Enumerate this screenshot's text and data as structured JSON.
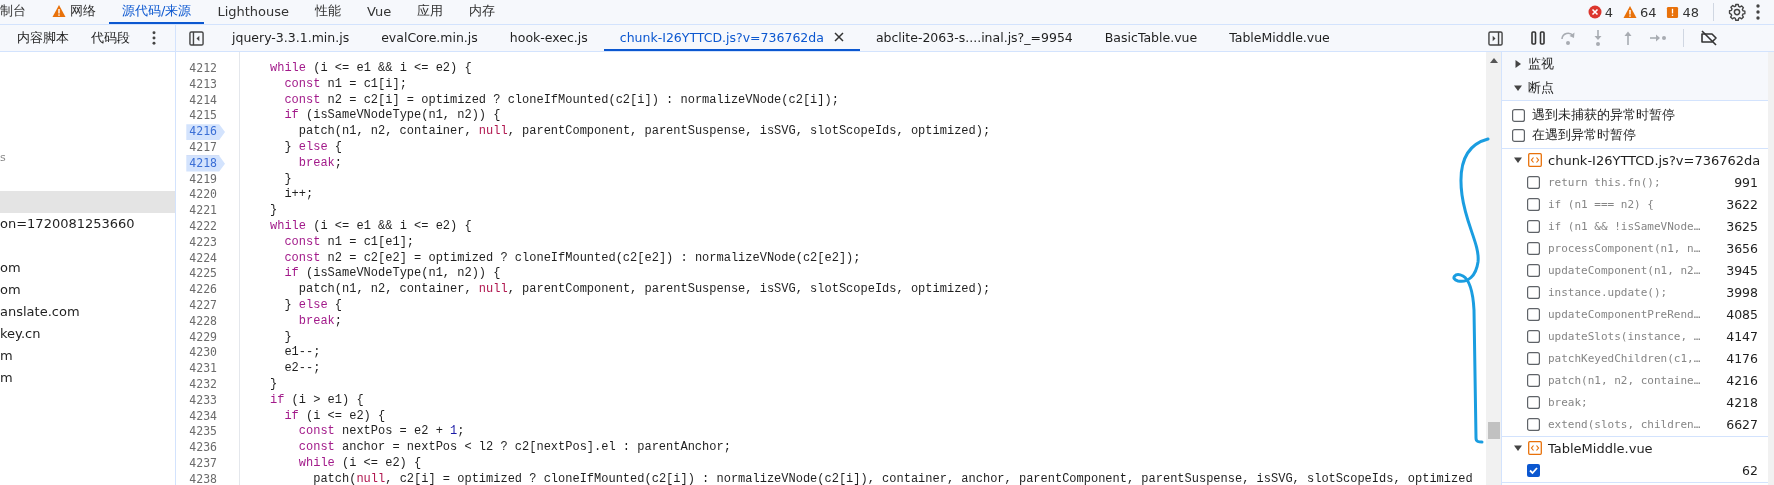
{
  "main_tabs": [
    {
      "label": "制台",
      "selected": false,
      "warning": false
    },
    {
      "label": "网络",
      "selected": false,
      "warning": true
    },
    {
      "label": "源代码/来源",
      "selected": true,
      "warning": false
    },
    {
      "label": "Lighthouse",
      "selected": false,
      "warning": false
    },
    {
      "label": "性能",
      "selected": false,
      "warning": false
    },
    {
      "label": "Vue",
      "selected": false,
      "warning": false
    },
    {
      "label": "应用",
      "selected": false,
      "warning": false
    },
    {
      "label": "内存",
      "selected": false,
      "warning": false
    }
  ],
  "console_counts": {
    "errors": "4",
    "warnings": "64",
    "issues": "48"
  },
  "navigator_tabs": [
    {
      "label": "内容脚本"
    },
    {
      "label": "代码段"
    }
  ],
  "file_tabs": [
    {
      "label": "jquery-3.3.1.min.js",
      "selected": false
    },
    {
      "label": "evalCore.min.js",
      "selected": false
    },
    {
      "label": "hook-exec.js",
      "selected": false
    },
    {
      "label": "chunk-I26YTTCD.js?v=736762da",
      "selected": true
    },
    {
      "label": "abclite-2063-s....inal.js?_=9954",
      "selected": false
    },
    {
      "label": "BasicTable.vue",
      "selected": false
    },
    {
      "label": "TableMiddle.vue",
      "selected": false
    }
  ],
  "debug_buttons": [
    {
      "kind": "pause",
      "disabled": false
    },
    {
      "kind": "step-over",
      "disabled": true
    },
    {
      "kind": "step-into",
      "disabled": true
    },
    {
      "kind": "step-out",
      "disabled": true
    },
    {
      "kind": "step",
      "disabled": true
    },
    {
      "kind": "deactivate",
      "disabled": false
    }
  ],
  "file_tree": [
    {
      "kind": "note",
      "label": "s",
      "selected": false
    },
    {
      "kind": "blank",
      "selected": false
    },
    {
      "kind": "blank",
      "selected": true
    },
    {
      "kind": "file",
      "label": "on=1720081253660",
      "selected": false
    },
    {
      "kind": "blank",
      "selected": false
    },
    {
      "kind": "file",
      "label": "om",
      "selected": false
    },
    {
      "kind": "file",
      "label": "om",
      "selected": false
    },
    {
      "kind": "file",
      "label": "anslate.com",
      "selected": false
    },
    {
      "kind": "file",
      "label": "key.cn",
      "selected": false
    },
    {
      "kind": "file",
      "label": "m",
      "selected": false
    },
    {
      "kind": "file",
      "label": "m",
      "selected": false
    }
  ],
  "editor": {
    "lines": [
      {
        "number": "4212",
        "breakpoint": false,
        "tokens": [
          {
            "kind": "keyword",
            "text": "while"
          },
          {
            "kind": "plain",
            "text": " (i <= e1 && i <= e2) {"
          }
        ]
      },
      {
        "number": "4213",
        "breakpoint": false,
        "tokens": [
          {
            "kind": "keyword",
            "text": "  const"
          },
          {
            "kind": "plain",
            "text": " n1 = c1[i];"
          }
        ]
      },
      {
        "number": "4214",
        "breakpoint": false,
        "tokens": [
          {
            "kind": "keyword",
            "text": "  const"
          },
          {
            "kind": "plain",
            "text": " n2 = c2[i] = optimized ? cloneIfMounted(c2[i]) : normalizeVNode(c2[i]);"
          }
        ]
      },
      {
        "number": "4215",
        "breakpoint": false,
        "tokens": [
          {
            "kind": "keyword",
            "text": "  if"
          },
          {
            "kind": "plain",
            "text": " (isSameVNodeType(n1, n2)) {"
          }
        ]
      },
      {
        "number": "4216",
        "breakpoint": true,
        "tokens": [
          {
            "kind": "plain",
            "text": "    patch(n1, n2, container, "
          },
          {
            "kind": "literal",
            "text": "null"
          },
          {
            "kind": "plain",
            "text": ", parentComponent, parentSuspense, isSVG, slotScopeIds, optimized);"
          }
        ]
      },
      {
        "number": "4217",
        "breakpoint": false,
        "tokens": [
          {
            "kind": "plain",
            "text": "  } "
          },
          {
            "kind": "keyword",
            "text": "else"
          },
          {
            "kind": "plain",
            "text": " {"
          }
        ]
      },
      {
        "number": "4218",
        "breakpoint": true,
        "tokens": [
          {
            "kind": "keyword",
            "text": "    break"
          },
          {
            "kind": "plain",
            "text": ";"
          }
        ]
      },
      {
        "number": "4219",
        "breakpoint": false,
        "tokens": [
          {
            "kind": "plain",
            "text": "  }"
          }
        ]
      },
      {
        "number": "4220",
        "breakpoint": false,
        "tokens": [
          {
            "kind": "plain",
            "text": "  i++;"
          }
        ]
      },
      {
        "number": "4221",
        "breakpoint": false,
        "tokens": [
          {
            "kind": "plain",
            "text": "}"
          }
        ]
      },
      {
        "number": "4222",
        "breakpoint": false,
        "tokens": [
          {
            "kind": "keyword",
            "text": "while"
          },
          {
            "kind": "plain",
            "text": " (i <= e1 && i <= e2) {"
          }
        ]
      },
      {
        "number": "4223",
        "breakpoint": false,
        "tokens": [
          {
            "kind": "keyword",
            "text": "  const"
          },
          {
            "kind": "plain",
            "text": " n1 = c1[e1];"
          }
        ]
      },
      {
        "number": "4224",
        "breakpoint": false,
        "tokens": [
          {
            "kind": "keyword",
            "text": "  const"
          },
          {
            "kind": "plain",
            "text": " n2 = c2[e2] = optimized ? cloneIfMounted(c2[e2]) : normalizeVNode(c2[e2]);"
          }
        ]
      },
      {
        "number": "4225",
        "breakpoint": false,
        "tokens": [
          {
            "kind": "keyword",
            "text": "  if"
          },
          {
            "kind": "plain",
            "text": " (isSameVNodeType(n1, n2)) {"
          }
        ]
      },
      {
        "number": "4226",
        "breakpoint": false,
        "tokens": [
          {
            "kind": "plain",
            "text": "    patch(n1, n2, container, "
          },
          {
            "kind": "literal",
            "text": "null"
          },
          {
            "kind": "plain",
            "text": ", parentComponent, parentSuspense, isSVG, slotScopeIds, optimized);"
          }
        ]
      },
      {
        "number": "4227",
        "breakpoint": false,
        "tokens": [
          {
            "kind": "plain",
            "text": "  } "
          },
          {
            "kind": "keyword",
            "text": "else"
          },
          {
            "kind": "plain",
            "text": " {"
          }
        ]
      },
      {
        "number": "4228",
        "breakpoint": false,
        "tokens": [
          {
            "kind": "keyword",
            "text": "    break"
          },
          {
            "kind": "plain",
            "text": ";"
          }
        ]
      },
      {
        "number": "4229",
        "breakpoint": false,
        "tokens": [
          {
            "kind": "plain",
            "text": "  }"
          }
        ]
      },
      {
        "number": "4230",
        "breakpoint": false,
        "tokens": [
          {
            "kind": "plain",
            "text": "  e1--;"
          }
        ]
      },
      {
        "number": "4231",
        "breakpoint": false,
        "tokens": [
          {
            "kind": "plain",
            "text": "  e2--;"
          }
        ]
      },
      {
        "number": "4232",
        "breakpoint": false,
        "tokens": [
          {
            "kind": "plain",
            "text": "}"
          }
        ]
      },
      {
        "number": "4233",
        "breakpoint": false,
        "tokens": [
          {
            "kind": "keyword",
            "text": "if"
          },
          {
            "kind": "plain",
            "text": " (i > e1) {"
          }
        ]
      },
      {
        "number": "4234",
        "breakpoint": false,
        "tokens": [
          {
            "kind": "keyword",
            "text": "  if"
          },
          {
            "kind": "plain",
            "text": " (i <= e2) {"
          }
        ]
      },
      {
        "number": "4235",
        "breakpoint": false,
        "tokens": [
          {
            "kind": "keyword",
            "text": "    const"
          },
          {
            "kind": "plain",
            "text": " nextPos = e2 + "
          },
          {
            "kind": "number",
            "text": "1"
          },
          {
            "kind": "plain",
            "text": ";"
          }
        ]
      },
      {
        "number": "4236",
        "breakpoint": false,
        "tokens": [
          {
            "kind": "keyword",
            "text": "    const"
          },
          {
            "kind": "plain",
            "text": " anchor = nextPos < l2 ? c2[nextPos].el : parentAnchor;"
          }
        ]
      },
      {
        "number": "4237",
        "breakpoint": false,
        "tokens": [
          {
            "kind": "keyword",
            "text": "    while"
          },
          {
            "kind": "plain",
            "text": " (i <= e2) {"
          }
        ]
      },
      {
        "number": "4238",
        "breakpoint": false,
        "tokens": [
          {
            "kind": "plain",
            "text": "      patch("
          },
          {
            "kind": "literal",
            "text": "null"
          },
          {
            "kind": "plain",
            "text": ", c2[i] = optimized ? cloneIfMounted(c2[i]) : normalizeVNode(c2[i]), container, anchor, parentComponent, parentSuspense, isSVG, slotScopeIds, optimized"
          }
        ]
      }
    ]
  },
  "debugger_sections": [
    {
      "title": "监视",
      "expanded": false
    },
    {
      "title": "断点",
      "expanded": true,
      "pause_options": [
        {
          "label": "遇到未捕获的异常时暂停",
          "checked": false
        },
        {
          "label": "在遇到异常时暂停",
          "checked": false
        }
      ],
      "files": [
        {
          "file": "chunk-I26YTTCD.js?v=736762da",
          "expanded": true,
          "breakpoints": [
            {
              "code": "return this.fn();",
              "line": "991",
              "checked": false
            },
            {
              "code": "if (n1 === n2) {",
              "line": "3622",
              "checked": false
            },
            {
              "code": "if (n1 && !isSameVNode…",
              "line": "3625",
              "checked": false
            },
            {
              "code": "processComponent(n1, n…",
              "line": "3656",
              "checked": false
            },
            {
              "code": "updateComponent(n1, n2…",
              "line": "3945",
              "checked": false
            },
            {
              "code": "instance.update();",
              "line": "3998",
              "checked": false
            },
            {
              "code": "updateComponentPreRend…",
              "line": "4085",
              "checked": false
            },
            {
              "code": "updateSlots(instance, …",
              "line": "4147",
              "checked": false
            },
            {
              "code": "patchKeyedChildren(c1,…",
              "line": "4176",
              "checked": false
            },
            {
              "code": "patch(n1, n2, containe…",
              "line": "4216",
              "checked": false
            },
            {
              "code": "break;",
              "line": "4218",
              "checked": false
            },
            {
              "code": "extend(slots, children…",
              "line": "6627",
              "checked": false
            }
          ]
        },
        {
          "file": "TableMiddle.vue",
          "expanded": true,
          "breakpoints": [
            {
              "line": "62",
              "checked": true
            }
          ]
        }
      ]
    }
  ]
}
